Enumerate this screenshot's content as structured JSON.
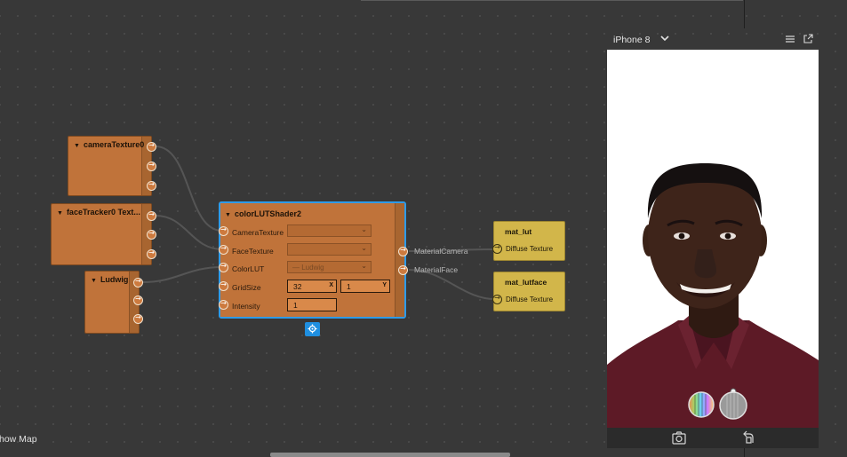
{
  "editor": {
    "show_map_label": "how Map",
    "nodes": {
      "camera_texture": {
        "title": "cameraTexture0"
      },
      "face_tracker": {
        "title": "faceTracker0 Text..."
      },
      "ludwig": {
        "title": "Ludwig"
      },
      "shader": {
        "title": "colorLUTShader2",
        "inputs": {
          "camera_texture": "CameraTexture",
          "face_texture": "FaceTexture",
          "color_lut": "ColorLUT",
          "grid_size": "GridSize",
          "intensity": "Intensity"
        },
        "values": {
          "color_lut_value": "Ludwig",
          "grid_x": "32",
          "grid_x_axis": "X",
          "grid_y": "1",
          "grid_y_axis": "Y",
          "intensity": "1"
        },
        "outputs": {
          "material_camera": "MaterialCamera",
          "material_face": "MaterialFace"
        }
      },
      "mat_lut": {
        "title": "mat_lut",
        "input": "Diffuse Texture"
      },
      "mat_lutface": {
        "title": "mat_lutface",
        "input": "Diffuse Texture"
      }
    }
  },
  "preview": {
    "device": "iPhone 8",
    "icons": [
      "chevron-down-icon",
      "menu-icon",
      "popout-icon",
      "capture-icon",
      "rotate-icon"
    ]
  },
  "colors": {
    "editor_bg": "#383838",
    "patch_orange": "#c0733a",
    "material_yellow": "#d2b64a",
    "selection_blue": "#2f9be8"
  }
}
